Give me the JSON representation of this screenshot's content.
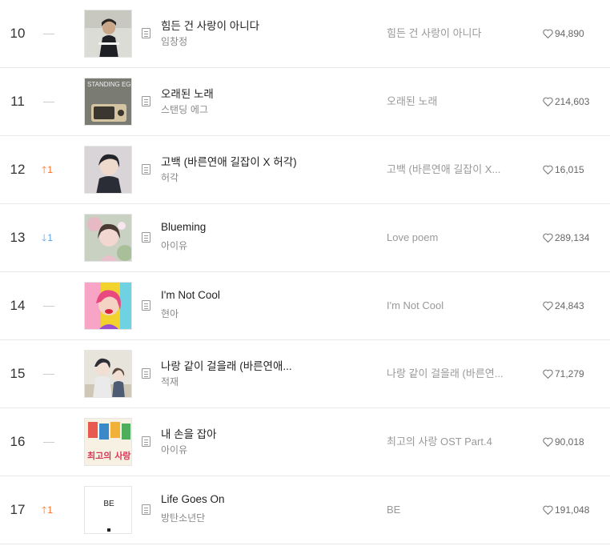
{
  "chart": {
    "rows": [
      {
        "rank": "10",
        "change_dir": "none",
        "change_val": "",
        "title": "힘든 건 사랑이 아니다",
        "artist": "임창정",
        "album": "힘든 건 사랑이 아니다",
        "likes": "94,890",
        "cover": "cover-imchangjung"
      },
      {
        "rank": "11",
        "change_dir": "none",
        "change_val": "",
        "title": "오래된 노래",
        "artist": "스탠딩 에그",
        "album": "오래된 노래",
        "likes": "214,603",
        "cover": "cover-standing-egg"
      },
      {
        "rank": "12",
        "change_dir": "up",
        "change_val": "1",
        "title": "고백 (바른연애 길잡이 X 허각)",
        "artist": "허각",
        "album": "고백 (바른연애 길잡이 X...",
        "likes": "16,015",
        "cover": "cover-webtoon-boy"
      },
      {
        "rank": "13",
        "change_dir": "down",
        "change_val": "1",
        "title": "Blueming",
        "artist": "아이유",
        "album": "Love poem",
        "likes": "289,134",
        "cover": "cover-iu-lovepoem"
      },
      {
        "rank": "14",
        "change_dir": "none",
        "change_val": "",
        "title": "I'm Not Cool",
        "artist": "현아",
        "album": "I'm Not Cool",
        "likes": "24,843",
        "cover": "cover-hyuna"
      },
      {
        "rank": "15",
        "change_dir": "none",
        "change_val": "",
        "title": "나랑 같이 걸을래 (바른연애...",
        "artist": "적재",
        "album": "나랑 같이 걸을래 (바른연...",
        "likes": "71,279",
        "cover": "cover-webtoon-couple"
      },
      {
        "rank": "16",
        "change_dir": "none",
        "change_val": "",
        "title": "내 손을 잡아",
        "artist": "아이유",
        "album": "최고의 사랑 OST Part.4",
        "likes": "90,018",
        "cover": "cover-best-love"
      },
      {
        "rank": "17",
        "change_dir": "up",
        "change_val": "1",
        "title": "Life Goes On",
        "artist": "방탄소년단",
        "album": "BE",
        "likes": "191,048",
        "cover": "cover-bts-be"
      }
    ]
  },
  "cover_text": {
    "standing_egg": "STANDING EGG",
    "be": "BE",
    "best_love": "최고의 사랑"
  },
  "colors": {
    "up": "#ff6b1c",
    "down": "#5aa0e6"
  }
}
